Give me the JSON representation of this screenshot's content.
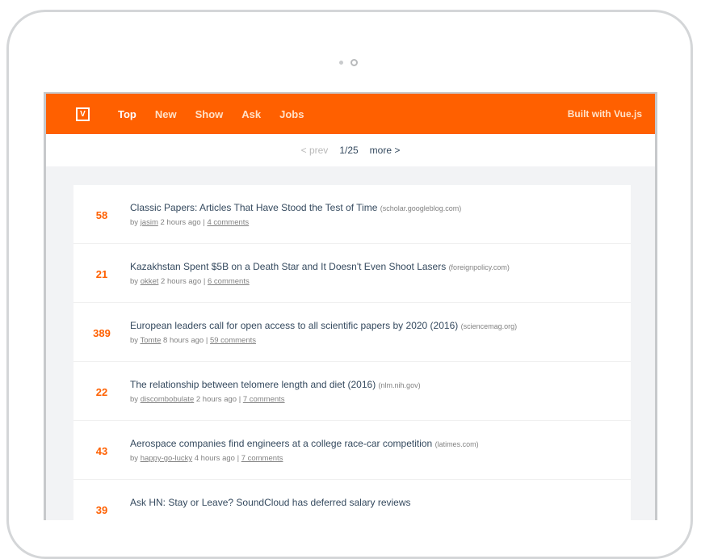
{
  "header": {
    "logo": "V",
    "nav": [
      "Top",
      "New",
      "Show",
      "Ask",
      "Jobs"
    ],
    "built_with": "Built with Vue.js"
  },
  "pager": {
    "prev": "< prev",
    "page": "1/25",
    "more": "more >"
  },
  "colors": {
    "brand": "#ff6000",
    "text": "#34495e",
    "muted": "#828282"
  },
  "stories": [
    {
      "score": "58",
      "title": "Classic Papers: Articles That Have Stood the Test of Time",
      "host": "(scholar.googleblog.com)",
      "by": "by",
      "user": "jasim",
      "time": "2 hours ago |",
      "comments": "4 comments"
    },
    {
      "score": "21",
      "title": "Kazakhstan Spent $5B on a Death Star and It Doesn't Even Shoot Lasers",
      "host": "(foreignpolicy.com)",
      "by": "by",
      "user": "okket",
      "time": "2 hours ago |",
      "comments": "6 comments"
    },
    {
      "score": "389",
      "title": "European leaders call for open access to all scientific papers by 2020 (2016)",
      "host": "(sciencemag.org)",
      "by": "by",
      "user": "Tomte",
      "time": "8 hours ago |",
      "comments": "59 comments"
    },
    {
      "score": "22",
      "title": "The relationship between telomere length and diet (2016)",
      "host": "(nlm.nih.gov)",
      "by": "by",
      "user": "discombobulate",
      "time": "2 hours ago |",
      "comments": "7 comments"
    },
    {
      "score": "43",
      "title": "Aerospace companies find engineers at a college race-car competition",
      "host": "(latimes.com)",
      "by": "by",
      "user": "happy-go-lucky",
      "time": "4 hours ago |",
      "comments": "7 comments"
    },
    {
      "score": "39",
      "title": "Ask HN: Stay or Leave? SoundCloud has deferred salary reviews",
      "host": "",
      "by": "",
      "user": "",
      "time": "",
      "comments": ""
    }
  ]
}
